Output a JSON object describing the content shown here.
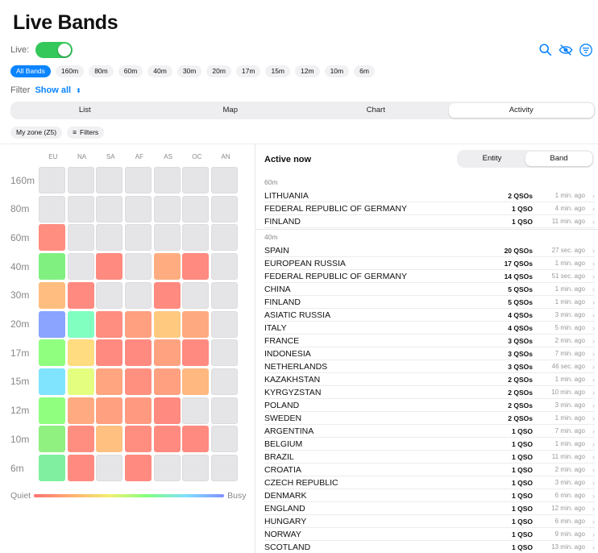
{
  "page": {
    "title": "Live Bands"
  },
  "live": {
    "label": "Live:",
    "on": true
  },
  "icons": [
    "search-icon",
    "eye-off-icon",
    "filter-icon"
  ],
  "bands": [
    "All Bands",
    "160m",
    "80m",
    "60m",
    "40m",
    "30m",
    "20m",
    "17m",
    "15m",
    "12m",
    "10m",
    "6m"
  ],
  "active_band": "All Bands",
  "filter": {
    "label": "Filter",
    "value": "Show all",
    "chevron": "⌃⌄"
  },
  "view_tabs": [
    "List",
    "Map",
    "Chart",
    "Activity"
  ],
  "selected_view": "Activity",
  "options": {
    "zone": "My zone (Z5)",
    "filters": "Filters"
  },
  "heatmap": {
    "continents": [
      "EU",
      "NA",
      "SA",
      "AF",
      "AS",
      "OC",
      "AN"
    ],
    "rows": [
      {
        "band": "160m",
        "colors": [
          "",
          "",
          "",
          "",
          "",
          "",
          ""
        ]
      },
      {
        "band": "80m",
        "colors": [
          "",
          "",
          "",
          "",
          "",
          "",
          ""
        ]
      },
      {
        "band": "60m",
        "colors": [
          "#ff8d80",
          "",
          "",
          "",
          "",
          "",
          ""
        ]
      },
      {
        "band": "40m",
        "colors": [
          "#80f080",
          "",
          "#ff8a80",
          "",
          "#ffad80",
          "#ff8a80",
          ""
        ]
      },
      {
        "band": "30m",
        "colors": [
          "#ffbd80",
          "#ff8a80",
          "",
          "",
          "#ff8a80",
          "",
          ""
        ]
      },
      {
        "band": "20m",
        "colors": [
          "#8aa4ff",
          "#80ffc0",
          "#ff8d80",
          "#ffa080",
          "#ffca80",
          "#ffa980",
          ""
        ]
      },
      {
        "band": "17m",
        "colors": [
          "#90ff80",
          "#ffdc80",
          "#ff8a80",
          "#ff8a80",
          "#ffa280",
          "#ff8a80",
          ""
        ]
      },
      {
        "band": "15m",
        "colors": [
          "#80e4ff",
          "#e4ff80",
          "#ffa580",
          "#ff9080",
          "#ffa080",
          "#ffb880",
          ""
        ]
      },
      {
        "band": "12m",
        "colors": [
          "#90ff80",
          "#ffaa80",
          "#ffa080",
          "#ff9a80",
          "#ff8a80",
          "",
          ""
        ]
      },
      {
        "band": "10m",
        "colors": [
          "#90f080",
          "#ff8d80",
          "#ffc080",
          "#ff8d80",
          "#ff8a80",
          "#ff8a80",
          ""
        ]
      },
      {
        "band": "6m",
        "colors": [
          "#80f0a0",
          "#ff8a80",
          "",
          "#ff8a80",
          "",
          "",
          ""
        ]
      }
    ]
  },
  "legend": {
    "quiet": "Quiet",
    "busy": "Busy"
  },
  "activity": {
    "title": "Active now",
    "segments": [
      "Entity",
      "Band"
    ],
    "selected_segment": "Band",
    "sections": [
      {
        "band": "60m",
        "rows": [
          {
            "entity": "LITHUANIA",
            "qsos": "2 QSOs",
            "ago": "1 min. ago"
          },
          {
            "entity": "FEDERAL REPUBLIC OF GERMANY",
            "qsos": "1 QSO",
            "ago": "4 min. ago"
          },
          {
            "entity": "FINLAND",
            "qsos": "1 QSO",
            "ago": "11 min. ago"
          }
        ]
      },
      {
        "band": "40m",
        "rows": [
          {
            "entity": "SPAIN",
            "qsos": "20 QSOs",
            "ago": "27 sec. ago"
          },
          {
            "entity": "EUROPEAN RUSSIA",
            "qsos": "17 QSOs",
            "ago": "1 min. ago"
          },
          {
            "entity": "FEDERAL REPUBLIC OF GERMANY",
            "qsos": "14 QSOs",
            "ago": "51 sec. ago"
          },
          {
            "entity": "CHINA",
            "qsos": "5 QSOs",
            "ago": "1 min. ago"
          },
          {
            "entity": "FINLAND",
            "qsos": "5 QSOs",
            "ago": "1 min. ago"
          },
          {
            "entity": "ASIATIC RUSSIA",
            "qsos": "4 QSOs",
            "ago": "3 min. ago"
          },
          {
            "entity": "ITALY",
            "qsos": "4 QSOs",
            "ago": "5 min. ago"
          },
          {
            "entity": "FRANCE",
            "qsos": "3 QSOs",
            "ago": "2 min. ago"
          },
          {
            "entity": "INDONESIA",
            "qsos": "3 QSOs",
            "ago": "7 min. ago"
          },
          {
            "entity": "NETHERLANDS",
            "qsos": "3 QSOs",
            "ago": "46 sec. ago"
          },
          {
            "entity": "KAZAKHSTAN",
            "qsos": "2 QSOs",
            "ago": "1 min. ago"
          },
          {
            "entity": "KYRGYZSTAN",
            "qsos": "2 QSOs",
            "ago": "10 min. ago"
          },
          {
            "entity": "POLAND",
            "qsos": "2 QSOs",
            "ago": "3 min. ago"
          },
          {
            "entity": "SWEDEN",
            "qsos": "2 QSOs",
            "ago": "1 min. ago"
          },
          {
            "entity": "ARGENTINA",
            "qsos": "1 QSO",
            "ago": "7 min. ago"
          },
          {
            "entity": "BELGIUM",
            "qsos": "1 QSO",
            "ago": "1 min. ago"
          },
          {
            "entity": "BRAZIL",
            "qsos": "1 QSO",
            "ago": "11 min. ago"
          },
          {
            "entity": "CROATIA",
            "qsos": "1 QSO",
            "ago": "2 min. ago"
          },
          {
            "entity": "CZECH REPUBLIC",
            "qsos": "1 QSO",
            "ago": "3 min. ago"
          },
          {
            "entity": "DENMARK",
            "qsos": "1 QSO",
            "ago": "6 min. ago"
          },
          {
            "entity": "ENGLAND",
            "qsos": "1 QSO",
            "ago": "12 min. ago"
          },
          {
            "entity": "HUNGARY",
            "qsos": "1 QSO",
            "ago": "6 min. ago"
          },
          {
            "entity": "NORWAY",
            "qsos": "1 QSO",
            "ago": "9 min. ago"
          },
          {
            "entity": "SCOTLAND",
            "qsos": "1 QSO",
            "ago": "13 min. ago"
          }
        ]
      }
    ]
  },
  "colors": {
    "accent": "#0a84ff",
    "toggle_on": "#34c759"
  }
}
